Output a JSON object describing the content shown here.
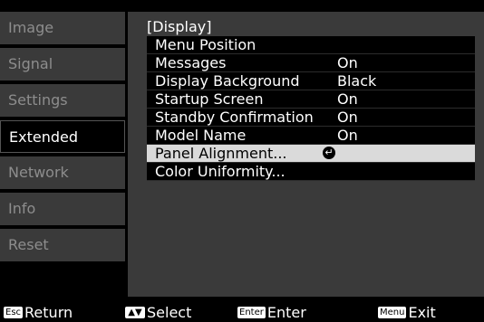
{
  "sidebar": {
    "tabs": [
      {
        "label": "Image"
      },
      {
        "label": "Signal"
      },
      {
        "label": "Settings"
      },
      {
        "label": "Extended"
      },
      {
        "label": "Network"
      },
      {
        "label": "Info"
      },
      {
        "label": "Reset"
      }
    ],
    "active_index": 3
  },
  "panel": {
    "title": "[Display]",
    "items": [
      {
        "label": "Menu Position",
        "value": ""
      },
      {
        "label": "Messages",
        "value": "On"
      },
      {
        "label": "Display Background",
        "value": "Black"
      },
      {
        "label": "Startup Screen",
        "value": "On"
      },
      {
        "label": "Standby Confirmation",
        "value": "On"
      },
      {
        "label": "Model Name",
        "value": "On"
      },
      {
        "label": "Panel Alignment...",
        "value": ""
      },
      {
        "label": "Color Uniformity...",
        "value": ""
      }
    ],
    "selected_index": 6,
    "enter_icon": "enter-arrow-icon"
  },
  "bottom_bar": {
    "return_key": "Esc",
    "return_label": "Return",
    "select_key": "▲▼",
    "select_label": "Select",
    "enter_key": "Enter",
    "enter_label": "Enter",
    "exit_key": "Menu",
    "exit_label": "Exit"
  },
  "colors": {
    "background": "#000000",
    "panel": "#3a3a3a",
    "selection": "#dadada",
    "text": "#ffffff"
  }
}
